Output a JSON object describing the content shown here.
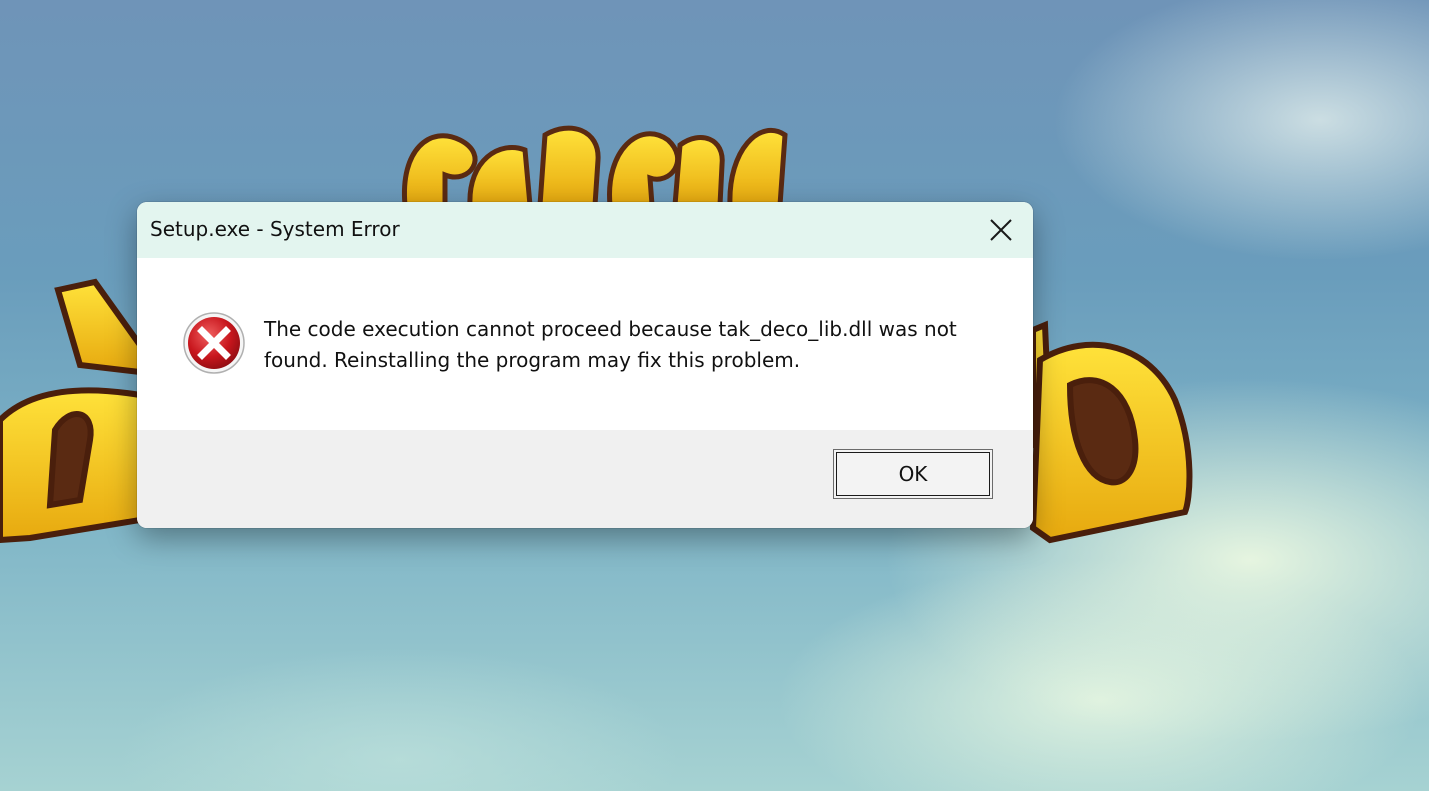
{
  "dialog": {
    "title": "Setup.exe - System Error",
    "close_icon": "close-icon",
    "error_icon": "error-x-icon",
    "message": "The code execution cannot proceed because tak_deco_lib.dll was not found. Reinstalling the program may fix this problem.",
    "ok_label": "OK"
  },
  "colors": {
    "titlebar": "#e3f5ef",
    "footer": "#f0f0f0",
    "error_red": "#c8161d",
    "logo_gold": "#f2c11a",
    "logo_brown": "#5a2a12"
  }
}
